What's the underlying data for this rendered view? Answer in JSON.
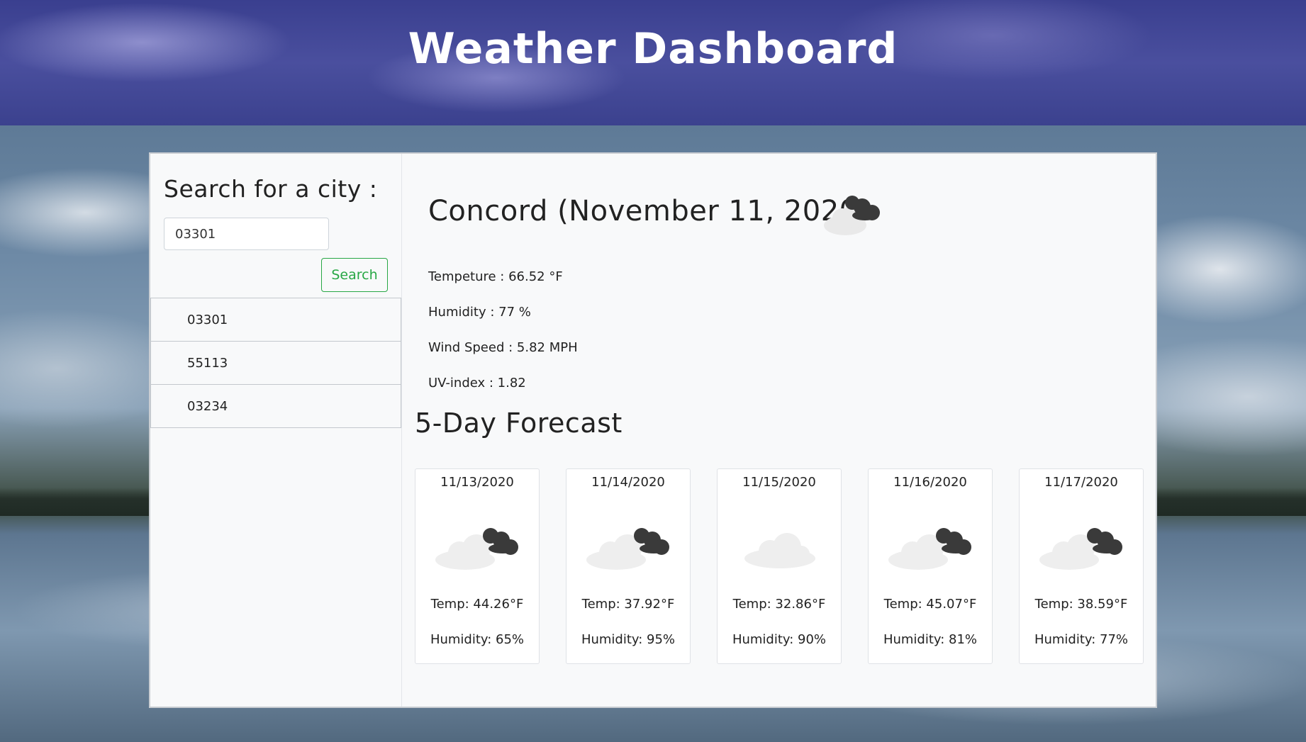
{
  "header": {
    "title": "Weather Dashboard"
  },
  "sidebar": {
    "heading": "Search for a city :",
    "search_value": "03301",
    "search_button": "Search",
    "history": [
      "03301",
      "55113",
      "03234"
    ]
  },
  "current": {
    "title": "Concord (November 11, 2020)",
    "icon": "cloudy-icon",
    "temperature": "Tempeture : 66.52 °F",
    "humidity": "Humidity : 77 %",
    "wind": "Wind Speed : 5.82 MPH",
    "uv": "UV-index : 1.82"
  },
  "forecast": {
    "heading": "5-Day Forecast",
    "days": [
      {
        "date": "11/13/2020",
        "icon": "cloudy-icon",
        "temp": "Temp: 44.26°F",
        "humidity": "Humidity: 65%"
      },
      {
        "date": "11/14/2020",
        "icon": "cloudy-icon",
        "temp": "Temp: 37.92°F",
        "humidity": "Humidity: 95%"
      },
      {
        "date": "11/15/2020",
        "icon": "light-cloud-icon",
        "temp": "Temp: 32.86°F",
        "humidity": "Humidity: 90%"
      },
      {
        "date": "11/16/2020",
        "icon": "cloudy-icon",
        "temp": "Temp: 45.07°F",
        "humidity": "Humidity: 81%"
      },
      {
        "date": "11/17/2020",
        "icon": "cloudy-icon",
        "temp": "Temp: 38.59°F",
        "humidity": "Humidity: 77%"
      }
    ]
  }
}
